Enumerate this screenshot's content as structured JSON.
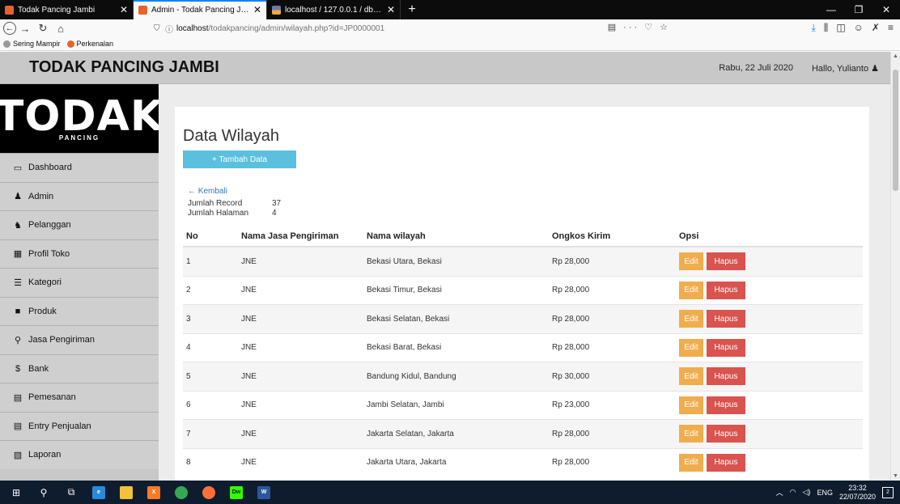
{
  "browser": {
    "tabs": [
      {
        "title": "Todak Pancing Jambi",
        "active": false
      },
      {
        "title": "Admin - Todak Pancing Jambi",
        "active": true
      },
      {
        "title": "localhost / 127.0.0.1 / db_todak",
        "active": false
      }
    ],
    "url_domain": "localhost",
    "url_path": "/todakpancing/admin/wilayah.php?id=JP0000001",
    "bookmarks": [
      "Sering Mampir",
      "Perkenalan"
    ]
  },
  "header": {
    "brand": "TODAK PANCING JAMBI",
    "date": "Rabu, 22 Juli 2020",
    "greeting": "Hallo, Yulianto"
  },
  "logo": {
    "text": "TODAK",
    "sub": "PANCING"
  },
  "sidebar": {
    "items": [
      {
        "label": "Dashboard",
        "icon": "desktop-icon",
        "glyph": "▭"
      },
      {
        "label": "Admin",
        "icon": "user-icon",
        "glyph": "♟"
      },
      {
        "label": "Pelanggan",
        "icon": "users-icon",
        "glyph": "♞"
      },
      {
        "label": "Profil Toko",
        "icon": "table-icon",
        "glyph": "▦"
      },
      {
        "label": "Kategori",
        "icon": "list-icon",
        "glyph": "☰"
      },
      {
        "label": "Produk",
        "icon": "briefcase-icon",
        "glyph": "■"
      },
      {
        "label": "Jasa Pengiriman",
        "icon": "map-marker-icon",
        "glyph": "⚲"
      },
      {
        "label": "Bank",
        "icon": "dollar-icon",
        "glyph": "$"
      },
      {
        "label": "Pemesanan",
        "icon": "credit-card-icon",
        "glyph": "▤"
      },
      {
        "label": "Entry Penjualan",
        "icon": "credit-card-icon",
        "glyph": "▤"
      },
      {
        "label": "Laporan",
        "icon": "file-icon",
        "glyph": "▧"
      }
    ]
  },
  "main": {
    "title": "Data Wilayah",
    "add_button": "+ Tambah Data",
    "back_link": "← Kembali",
    "jumlah_record_label": "Jumlah Record",
    "jumlah_record_value": "37",
    "jumlah_halaman_label": "Jumlah Halaman",
    "jumlah_halaman_value": "4",
    "columns": [
      "No",
      "Nama Jasa Pengiriman",
      "Nama wilayah",
      "Ongkos Kirim",
      "Opsi"
    ],
    "edit_label": "Edit",
    "delete_label": "Hapus",
    "rows": [
      {
        "no": "1",
        "jasa": "JNE",
        "wilayah": "Bekasi Utara, Bekasi",
        "ongkos": "Rp 28,000"
      },
      {
        "no": "2",
        "jasa": "JNE",
        "wilayah": "Bekasi Timur, Bekasi",
        "ongkos": "Rp 28,000"
      },
      {
        "no": "3",
        "jasa": "JNE",
        "wilayah": "Bekasi Selatan, Bekasi",
        "ongkos": "Rp 28,000"
      },
      {
        "no": "4",
        "jasa": "JNE",
        "wilayah": "Bekasi Barat, Bekasi",
        "ongkos": "Rp 28,000"
      },
      {
        "no": "5",
        "jasa": "JNE",
        "wilayah": "Bandung Kidul, Bandung",
        "ongkos": "Rp 30,000"
      },
      {
        "no": "6",
        "jasa": "JNE",
        "wilayah": "Jambi Selatan, Jambi",
        "ongkos": "Rp 23,000"
      },
      {
        "no": "7",
        "jasa": "JNE",
        "wilayah": "Jakarta Selatan, Jakarta",
        "ongkos": "Rp 28,000"
      },
      {
        "no": "8",
        "jasa": "JNE",
        "wilayah": "Jakarta Utara, Jakarta",
        "ongkos": "Rp 28,000"
      }
    ]
  },
  "taskbar": {
    "language": "ENG",
    "time": "23:32",
    "date": "22/07/2020",
    "notification_count": "2"
  },
  "colors": {
    "info": "#5bc0de",
    "warning": "#f0ad4e",
    "danger": "#d9534f",
    "header_bg": "#c8c8c8"
  }
}
